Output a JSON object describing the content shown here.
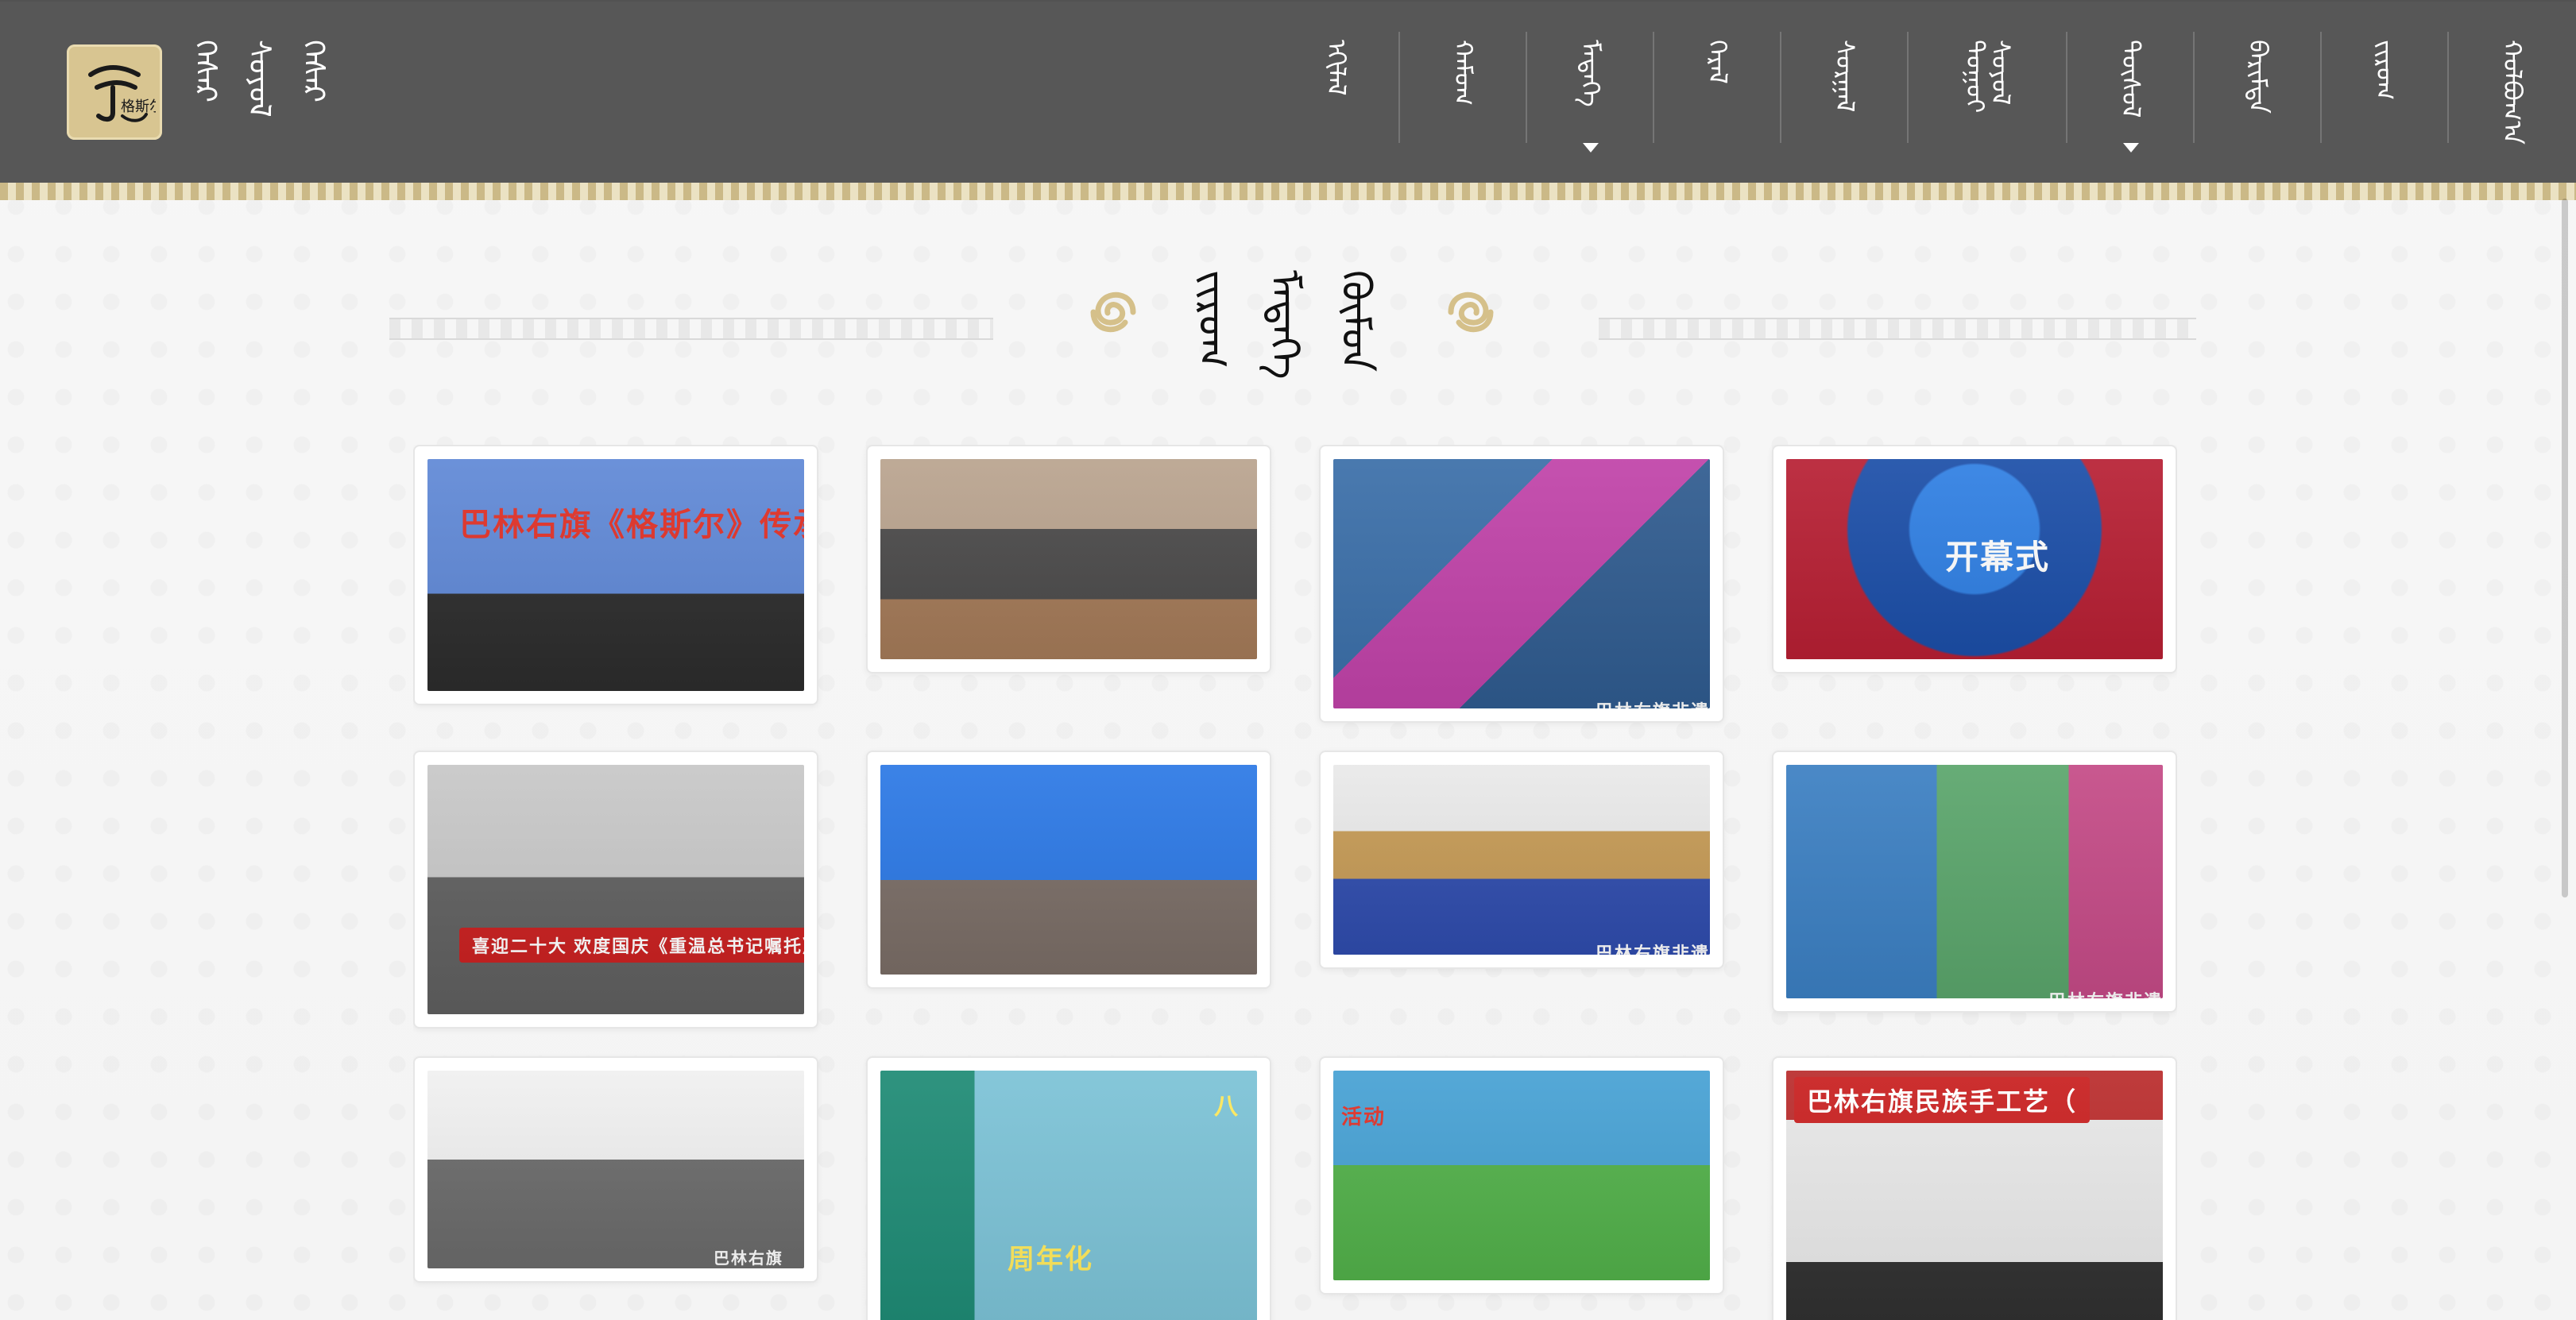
{
  "header": {
    "brand_lines": [
      "ᠭᠡᠰᠡᠷ",
      "ᠰᠤᠶᠤᠯ",
      "ᠭᠡᠰᠡᠷ"
    ],
    "logo_text": "格斯尔",
    "nav": [
      {
        "label": "ᠡᠬᠢᠯᠡᠯ",
        "has_caret": false
      },
      {
        "label": "ᠬᠠᠮᠤᠭ",
        "has_caret": false
      },
      {
        "label": "ᠮᠡᠳᠡᠭᠡ",
        "has_caret": true
      },
      {
        "label": "ᠭᠡᠷᠡᠯ",
        "has_caret": false
      },
      {
        "label": "ᠰᠤᠷᠭᠠᠯ",
        "has_caret": false
      },
      {
        "label": "ᠳᠣᠭᠣᠢ ᠰᠤᠶᠤᠯ",
        "has_caret": false
      },
      {
        "label": "ᠲᠥᠰᠥᠯ",
        "has_caret": true
      },
      {
        "label": "ᠪᠠᠷᠢᠮᠲᠠ",
        "has_caret": false
      },
      {
        "label": "ᠵᠢᠷᠤᠭ",
        "has_caret": false
      },
      {
        "label": "ᠬᠣᠯᠪᠣᠭ᠎ᠠ",
        "has_caret": false
      }
    ]
  },
  "section": {
    "title_lines": [
      "ᠵᠢᠷᠤᠭ",
      "ᠮᠡᠳᠡᠭᠡ",
      "ᠬᠥᠮᠦᠨ"
    ]
  },
  "gallery": {
    "cards": [
      {
        "caption": "巴林右旗《格斯尔》传承",
        "overlay": ""
      },
      {
        "caption": "",
        "overlay": ""
      },
      {
        "caption": "",
        "overlay": "巴林右旗非遗保护"
      },
      {
        "caption": "开幕式",
        "overlay": ""
      },
      {
        "caption": "喜迎二十大 欢度国庆《重温总书记嘱托》主题活动",
        "overlay": ""
      },
      {
        "caption": "",
        "overlay": ""
      },
      {
        "caption": "",
        "overlay": "巴林右旗非遗保护"
      },
      {
        "caption": "",
        "overlay": "巴林右旗非遗保护"
      },
      {
        "caption": "",
        "overlay": "巴林右旗"
      },
      {
        "caption": "周年化",
        "overlay": "八"
      },
      {
        "caption": "活动",
        "overlay": ""
      },
      {
        "caption": "巴林右旗民族手工艺（",
        "overlay": ""
      }
    ]
  },
  "colors": {
    "header_bg": "#575757",
    "accent_gold": "#d4c38f",
    "title_text": "#111111"
  }
}
